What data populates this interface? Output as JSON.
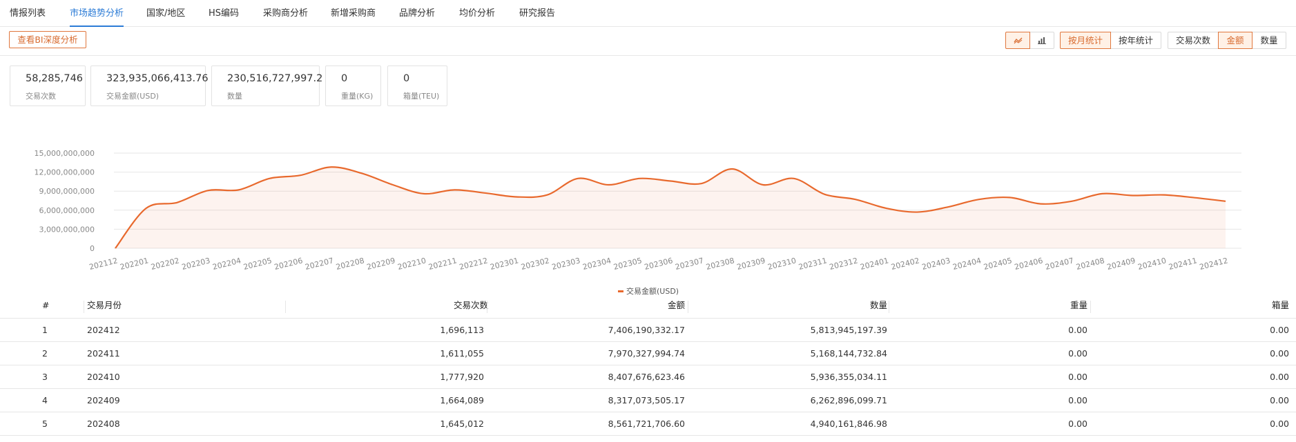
{
  "nav": {
    "tabs": [
      {
        "label": "情报列表",
        "active": false
      },
      {
        "label": "市场趋势分析",
        "active": true
      },
      {
        "label": "国家/地区",
        "active": false
      },
      {
        "label": "HS编码",
        "active": false
      },
      {
        "label": "采购商分析",
        "active": false
      },
      {
        "label": "新增采购商",
        "active": false
      },
      {
        "label": "品牌分析",
        "active": false
      },
      {
        "label": "均价分析",
        "active": false
      },
      {
        "label": "研究报告",
        "active": false
      }
    ]
  },
  "toolbar": {
    "bi_button": "查看BI深度分析",
    "chart_types": [
      {
        "icon": "line-chart-icon",
        "active": true
      },
      {
        "icon": "bar-chart-icon",
        "active": false
      }
    ],
    "period": [
      {
        "label": "按月统计",
        "active": true
      },
      {
        "label": "按年统计",
        "active": false
      }
    ],
    "metric": [
      {
        "label": "交易次数",
        "active": false
      },
      {
        "label": "金额",
        "active": true
      },
      {
        "label": "数量",
        "active": false
      }
    ]
  },
  "stats": [
    {
      "value": "58,285,746",
      "label": "交易次数"
    },
    {
      "value": "323,935,066,413.76",
      "label": "交易金额(USD)"
    },
    {
      "value": "230,516,727,997.2",
      "label": "数量"
    },
    {
      "value": "0",
      "label": "重量(KG)"
    },
    {
      "value": "0",
      "label": "箱量(TEU)"
    }
  ],
  "colors": {
    "accent": "#e8692d",
    "nav_active": "#2b7bd6"
  },
  "chart_data": {
    "type": "area",
    "x": [
      "202112",
      "202201",
      "202202",
      "202203",
      "202204",
      "202205",
      "202206",
      "202207",
      "202208",
      "202209",
      "202210",
      "202211",
      "202212",
      "202301",
      "202302",
      "202303",
      "202304",
      "202305",
      "202306",
      "202307",
      "202308",
      "202309",
      "202310",
      "202311",
      "202312",
      "202401",
      "202402",
      "202403",
      "202404",
      "202405",
      "202406",
      "202407",
      "202408",
      "202409",
      "202410",
      "202411",
      "202412"
    ],
    "series": [
      {
        "name": "交易金额(USD)",
        "values": [
          0,
          6300000000,
          7200000000,
          9100000000,
          9200000000,
          11000000000,
          11500000000,
          12800000000,
          11800000000,
          10000000000,
          8600000000,
          9200000000,
          8700000000,
          8100000000,
          8400000000,
          11000000000,
          10000000000,
          11000000000,
          10600000000,
          10200000000,
          12500000000,
          10000000000,
          11000000000,
          8500000000,
          7700000000,
          6300000000,
          5700000000,
          6500000000,
          7700000000,
          8000000000,
          7000000000,
          7400000000,
          8600000000,
          8317073505,
          8407676623,
          7970327995,
          7406190332
        ]
      }
    ],
    "y_ticks": [
      "15,000,000,000",
      "12,000,000,000",
      "9,000,000,000",
      "6,000,000,000",
      "3,000,000,000",
      "0"
    ],
    "ylim": [
      0,
      15000000000
    ],
    "legend": "bottom-center",
    "grid": true
  },
  "table": {
    "headers": [
      "#",
      "交易月份",
      "交易次数",
      "金额",
      "数量",
      "重量",
      "箱量"
    ],
    "rows": [
      [
        "1",
        "202412",
        "1,696,113",
        "7,406,190,332.17",
        "5,813,945,197.39",
        "0.00",
        "0.00"
      ],
      [
        "2",
        "202411",
        "1,611,055",
        "7,970,327,994.74",
        "5,168,144,732.84",
        "0.00",
        "0.00"
      ],
      [
        "3",
        "202410",
        "1,777,920",
        "8,407,676,623.46",
        "5,936,355,034.11",
        "0.00",
        "0.00"
      ],
      [
        "4",
        "202409",
        "1,664,089",
        "8,317,073,505.17",
        "6,262,896,099.71",
        "0.00",
        "0.00"
      ],
      [
        "5",
        "202408",
        "1,645,012",
        "8,561,721,706.60",
        "4,940,161,846.98",
        "0.00",
        "0.00"
      ]
    ]
  }
}
